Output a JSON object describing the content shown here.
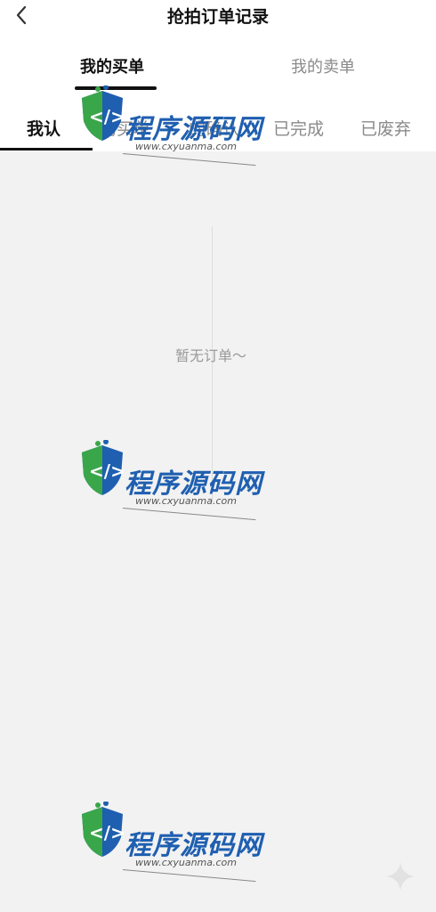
{
  "header": {
    "title": "抢拍订单记录",
    "back_icon": "chevron-left-icon"
  },
  "main_tabs": [
    {
      "label": "我的买单",
      "active": true
    },
    {
      "label": "我的卖单",
      "active": false
    }
  ],
  "sub_tabs": [
    {
      "label": "我认",
      "active": true
    },
    {
      "label": "的买单",
      "active": false
    },
    {
      "label": "的确认",
      "active": false
    },
    {
      "label": "已完成",
      "active": false
    },
    {
      "label": "已废弃",
      "active": false
    }
  ],
  "empty_state": {
    "text": "暂无订单～"
  },
  "watermark": {
    "title": "程序源码网",
    "url": "www.cxyuanma.com"
  },
  "colors": {
    "background": "#f2f2f2",
    "active_text": "#111111",
    "inactive_text": "#8a8a8a",
    "watermark_blue": "#1f5fb0",
    "watermark_green": "#3aa64a"
  }
}
